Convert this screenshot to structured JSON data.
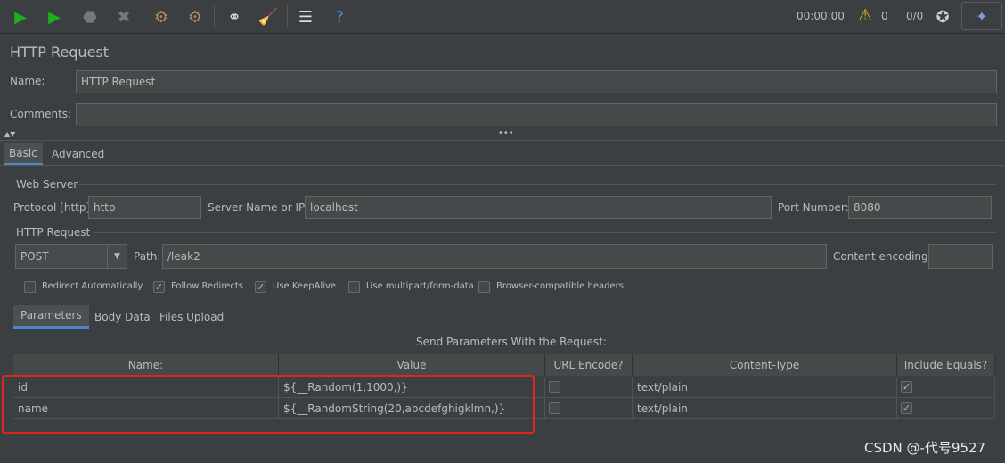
{
  "toolbar": {
    "icons": [
      "start-icon",
      "start-no-pause-icon",
      "stop-icon",
      "shutdown-icon",
      "clear-icon",
      "clear-all-icon",
      "search-icon",
      "reset-search-icon",
      "function-helper-icon",
      "help-icon"
    ],
    "timer": "00:00:00",
    "warnings": "0",
    "threads": "0/0"
  },
  "title": "HTTP Request",
  "name_label": "Name:",
  "name_value": "HTTP Request",
  "comments_label": "Comments:",
  "comments_value": "",
  "tabs": [
    "Basic",
    "Advanced"
  ],
  "web_server": {
    "legend": "Web Server",
    "protocol_label": "Protocol [http]:",
    "protocol": "http",
    "server_label": "Server Name or IP:",
    "server": "localhost",
    "port_label": "Port Number:",
    "port": "8080"
  },
  "http_request": {
    "legend": "HTTP Request",
    "method": "POST",
    "path_label": "Path:",
    "path": "/leak2",
    "encoding_label": "Content encoding:",
    "encoding": ""
  },
  "checkboxes": [
    {
      "label": "Redirect Automatically",
      "checked": false
    },
    {
      "label": "Follow Redirects",
      "checked": true
    },
    {
      "label": "Use KeepAlive",
      "checked": true
    },
    {
      "label": "Use multipart/form-data",
      "checked": false
    },
    {
      "label": "Browser-compatible headers",
      "checked": false
    }
  ],
  "param_tabs": [
    "Parameters",
    "Body Data",
    "Files Upload"
  ],
  "send_params_label": "Send Parameters With the Request:",
  "table": {
    "headers": [
      "Name:",
      "Value",
      "URL Encode?",
      "Content-Type",
      "Include Equals?"
    ],
    "rows": [
      {
        "name": "id",
        "value": "${__Random(1,1000,)}",
        "url_encode": false,
        "content_type": "text/plain",
        "include_equals": true
      },
      {
        "name": "name",
        "value": "${__RandomString(20,abcdefghigklmn,)}",
        "url_encode": false,
        "content_type": "text/plain",
        "include_equals": true
      }
    ]
  },
  "highlight_color": "#e0261c",
  "watermark": "CSDN @-代号9527"
}
